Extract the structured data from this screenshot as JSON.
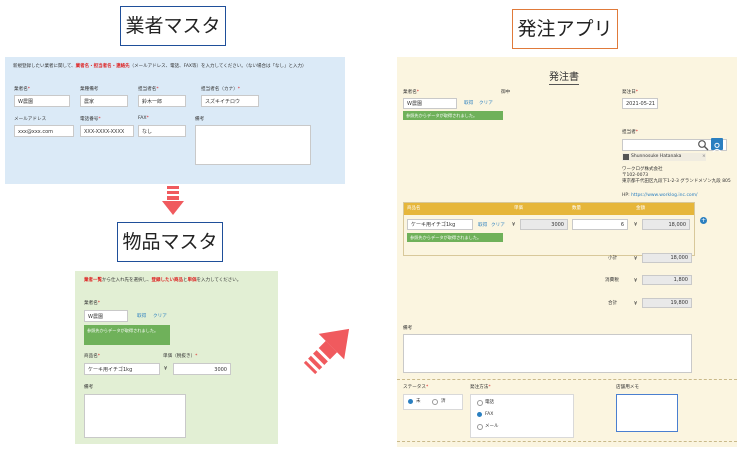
{
  "titles": {
    "gyosha": "業者マスタ",
    "hinmoku": "物品マスタ",
    "hatchu": "発注アプリ"
  },
  "colors": {
    "gyosha_bg": "#dbeaf7",
    "hinmoku_bg": "#e2efd4",
    "hatchu_bg": "#fbf5e0",
    "arrow": "#f05a5e",
    "table_header": "#e6b63a",
    "note_green": "#6fb15a"
  },
  "gyosha": {
    "instruction_pre": "新規登録したい業者に関して、",
    "instruction_red": "業者名・担当者名・連絡先",
    "instruction_post": "（メールアドレス、電話、FAX等）を入力してください。（ない場合は「なし」と入力）",
    "labels": {
      "vendor": "業者名",
      "vendor_note": "業種備考",
      "person": "担当者名",
      "person_kana": "担当者名（カナ）",
      "email": "メールアドレス",
      "phone": "電話番号",
      "fax": "FAX",
      "memo": "備考"
    },
    "values": {
      "vendor": "W農園",
      "vendor_note": "農家",
      "person": "鈴木一郎",
      "person_kana": "スズキイチロウ",
      "email": "xxx@xxx.com",
      "phone": "XXX-XXXX-XXXX",
      "fax": "なし"
    }
  },
  "hinmoku": {
    "instruction_a": "業者一覧",
    "instruction_b": "から仕入れ先を選択し、",
    "instruction_c": "登録したい商品",
    "instruction_d": "と",
    "instruction_e": "単価",
    "instruction_f": "を入力してください。",
    "labels": {
      "vendor": "業者名",
      "item": "商品名",
      "price": "単価（税抜き）",
      "memo": "備考"
    },
    "values": {
      "vendor": "W農園",
      "item": "ケーキ用イチゴ1kg",
      "price": "3000",
      "yen": "¥"
    },
    "get_link": "取得",
    "clear_link": "クリア",
    "note": "参照先からデータが取得されました。"
  },
  "hatchu": {
    "heading": "発注書",
    "labels": {
      "vendor": "業者名",
      "sama": "御中",
      "order_date": "発注日",
      "person_in_charge": "担当者",
      "status": "ステータス",
      "order_method": "発注方法",
      "store_memo": "店舗用メモ",
      "memo": "備考",
      "subtotal": "小計",
      "tax": "消費税",
      "total": "合計",
      "hp": "HP:"
    },
    "values": {
      "vendor": "W農園",
      "order_date": "2021-05-21",
      "user": "Shunnosuke Hatanaka",
      "company_name": "ワークログ株式会社",
      "zip": "〒102-0073",
      "address": "東京都千代田区九段下1-2-3 グランドメゾン九段 805",
      "hp_url": "https://www.worklog.inc.com/",
      "row_item": "ケーキ用イチゴ1kg",
      "row_price": "3000",
      "row_amount": "18,000",
      "subtotal": "18,000",
      "tax": "1,800",
      "total": "19,800",
      "yen": "¥"
    },
    "table_headers": [
      "商品名",
      "単価",
      "数量",
      "金額"
    ],
    "get_link": "取得",
    "clear_link": "クリア",
    "note": "参照先からデータが取得されました。",
    "status_options": [
      "未",
      "済"
    ],
    "method_options": [
      "電話",
      "FAX",
      "メール"
    ]
  }
}
